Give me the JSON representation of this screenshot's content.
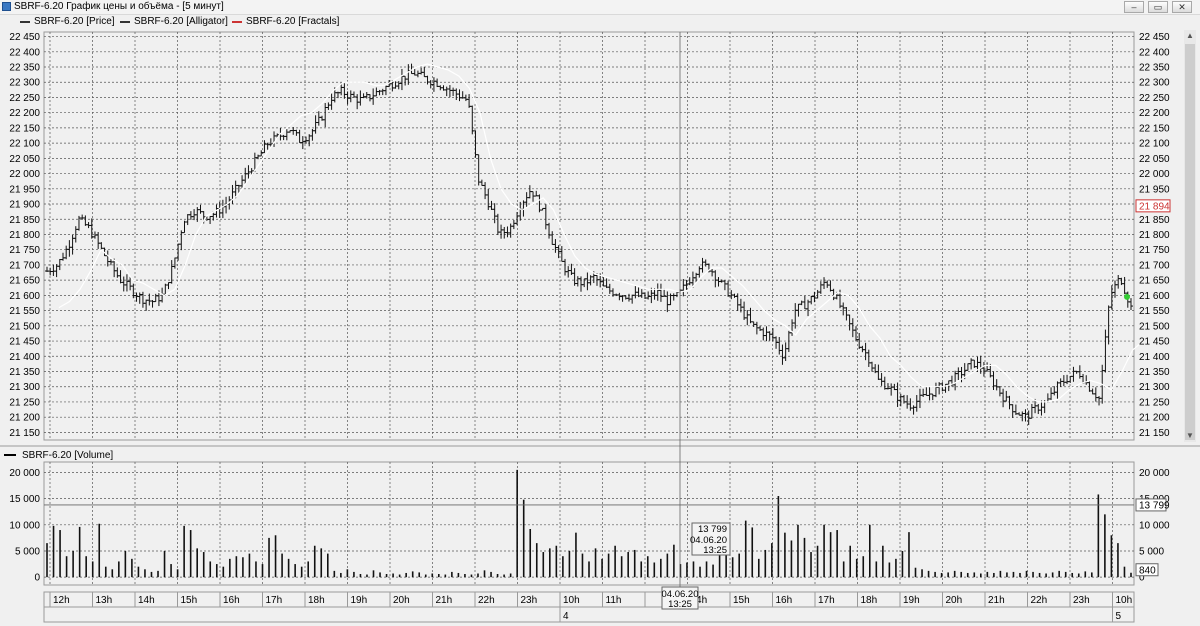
{
  "window": {
    "title": "SBRF-6.20 График цены и объёма - [5 минут]",
    "buttons": {
      "minimize": "–",
      "restore": "▭",
      "close": "✕"
    }
  },
  "legend": [
    {
      "label": "SBRF-6.20 [Price]",
      "color": "#333333"
    },
    {
      "label": "SBRF-6.20 [Alligator]",
      "color": "#333333"
    },
    {
      "label": "SBRF-6.20 [Fractals]",
      "color": "#cc3333"
    }
  ],
  "volume_legend": {
    "label": "SBRF-6.20 [Volume]"
  },
  "crosshair": {
    "volume": "13 799",
    "date": "04.06.20",
    "time": "13:25"
  },
  "axis_markers": {
    "last_price": "21 894",
    "volume_level": "13 799",
    "last_volume": "840"
  },
  "chart_data": [
    {
      "type": "bar",
      "name": "price",
      "title": "",
      "ylim": [
        21125,
        22465
      ],
      "yticks": [
        21150,
        21200,
        21250,
        21300,
        21350,
        21400,
        21450,
        21500,
        21550,
        21600,
        21650,
        21700,
        21750,
        21800,
        21850,
        21900,
        21950,
        22000,
        22050,
        22100,
        22150,
        22200,
        22250,
        22300,
        22350,
        22400,
        22450
      ],
      "ytick_labels": [
        "21 150",
        "21 200",
        "21 250",
        "21 300",
        "21 350",
        "21 400",
        "21 450",
        "21 500",
        "21 550",
        "21 600",
        "21 650",
        "21 700",
        "21 750",
        "21 800",
        "21 850",
        "21 900",
        "21 950",
        "22 000",
        "22 050",
        "22 100",
        "22 150",
        "22 200",
        "22 250",
        "22 300",
        "22 350",
        "22 400",
        "22 450"
      ],
      "close_path": [
        21680,
        21700,
        21760,
        21850,
        21820,
        21760,
        21700,
        21650,
        21620,
        21590,
        21580,
        21600,
        21700,
        21850,
        21880,
        21860,
        21870,
        21900,
        21950,
        22000,
        22050,
        22100,
        22120,
        22150,
        22110,
        22130,
        22180,
        22250,
        22270,
        22250,
        22240,
        22260,
        22280,
        22300,
        22320,
        22330,
        22310,
        22300,
        22280,
        22260,
        22240,
        21980,
        21900,
        21800,
        21820,
        21900,
        21950,
        21880,
        21780,
        21700,
        21650,
        21640,
        21660,
        21620,
        21610,
        21600,
        21600,
        21590,
        21610,
        21580,
        21600,
        21650,
        21700,
        21690,
        21640,
        21600,
        21550,
        21500,
        21480,
        21460,
        21400,
        21550,
        21570,
        21600,
        21650,
        21590,
        21520,
        21450,
        21400,
        21320,
        21300,
        21260,
        21240,
        21260,
        21280,
        21300,
        21320,
        21350,
        21380,
        21360,
        21310,
        21260,
        21220,
        21200,
        21230,
        21250,
        21300,
        21330,
        21350,
        21300,
        21260,
        21600,
        21660,
        21560
      ],
      "alligator": [
        [
          21560,
          21580,
          21620,
          21680,
          21750,
          21720,
          21700,
          21650,
          21640,
          21620,
          21600,
          21620,
          21700,
          21800,
          21860,
          21880,
          21900,
          21930,
          21980,
          22030,
          22080,
          22130,
          22160,
          22190,
          22200,
          22230,
          22270,
          22300,
          22300,
          22300,
          22290,
          22290,
          22310,
          22330,
          22350,
          22360,
          22350,
          22340,
          22320,
          22280,
          22200,
          22050,
          21950,
          21900,
          21880,
          21900,
          21920,
          21880,
          21800,
          21730,
          21690,
          21670,
          21660,
          21650,
          21640,
          21630,
          21620,
          21620,
          21620,
          21610,
          21620,
          21660,
          21690,
          21690,
          21660,
          21630,
          21590,
          21550,
          21520,
          21500,
          21470,
          21520,
          21550,
          21580,
          21610,
          21600,
          21560,
          21500,
          21460,
          21400,
          21370,
          21330,
          21300,
          21300,
          21300,
          21310,
          21330,
          21350,
          21370,
          21370,
          21340,
          21300,
          21270,
          21250,
          21250,
          21260,
          21290,
          21310,
          21320,
          21310,
          21290,
          21350,
          21420,
          21450
        ]
      ]
    },
    {
      "type": "bar",
      "name": "volume",
      "title": "",
      "ylim": [
        -1500,
        22000
      ],
      "yticks": [
        0,
        5000,
        10000,
        15000,
        20000
      ],
      "ytick_labels": [
        "0",
        "5 000",
        "10 000",
        "15 000",
        "20 000"
      ],
      "values": [
        6500,
        9800,
        9000,
        4000,
        5000,
        9600,
        4000,
        3000,
        10200,
        2000,
        1500,
        3000,
        5000,
        3500,
        2000,
        1500,
        1000,
        1200,
        5000,
        2500,
        1500,
        9800,
        9000,
        5500,
        4800,
        3000,
        2500,
        2000,
        3500,
        4000,
        3800,
        4500,
        3000,
        2500,
        7500,
        8000,
        4500,
        3500,
        2500,
        2000,
        3000,
        6000,
        5500,
        4500,
        1200,
        800,
        1500,
        1000,
        600,
        500,
        1300,
        900,
        600,
        700,
        500,
        800,
        1100,
        900,
        500,
        700,
        600,
        500,
        1000,
        800,
        600,
        500,
        700,
        1300,
        1000,
        600,
        500,
        700,
        20500,
        14800,
        9200,
        6500,
        4800,
        5500,
        6000,
        4000,
        5000,
        8500,
        4500,
        3000,
        5500,
        3500,
        4500,
        6000,
        4000,
        4800,
        5200,
        3000,
        4000,
        2800,
        3500,
        4500,
        6200,
        2500,
        2800,
        3000,
        2000,
        3000,
        2400,
        8900,
        10000,
        3800,
        4500,
        10800,
        9500,
        3500,
        5200,
        6500,
        15500,
        8500,
        7000,
        10000,
        7500,
        4800,
        6000,
        10000,
        8600,
        9000,
        3000,
        6000,
        3500,
        4000,
        10000,
        3000,
        6000,
        2800,
        3500,
        5000,
        8600,
        1800,
        1500,
        1200,
        1000,
        800,
        900,
        1200,
        1000,
        800,
        900,
        700,
        1000,
        800,
        1200,
        900,
        1000,
        800,
        1200,
        1000,
        800,
        700,
        900,
        1200,
        1000,
        800,
        700,
        1100,
        900,
        15800,
        12000,
        8000,
        6500,
        2000,
        840
      ],
      "current_volume": 13799,
      "last_volume": 840
    }
  ],
  "time_axis": {
    "hours": [
      "12h",
      "13h",
      "14h",
      "15h",
      "16h",
      "17h",
      "18h",
      "19h",
      "20h",
      "21h",
      "22h",
      "23h",
      "10h",
      "11h",
      "12h",
      "14h",
      "15h",
      "16h",
      "17h",
      "18h",
      "19h",
      "20h",
      "21h",
      "22h",
      "23h",
      "10h"
    ],
    "days": [
      "4",
      "5"
    ],
    "crosshair_date": "04.06.20",
    "crosshair_time": "13:25"
  }
}
